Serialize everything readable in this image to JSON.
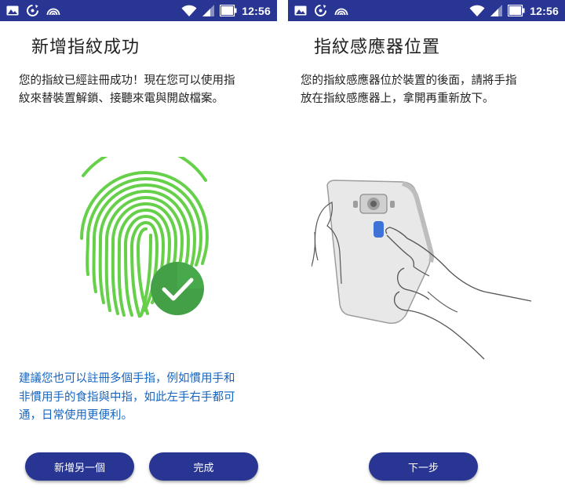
{
  "status_bar": {
    "time": "12:56",
    "background": "#283593",
    "left_icons": [
      "image-icon",
      "sync-icon",
      "hotspot-icon"
    ],
    "right_icons": [
      "wifi-icon",
      "cellular-signal-icon",
      "battery-icon"
    ]
  },
  "left_screen": {
    "title": "新增指紋成功",
    "body_lines": [
      "您的指紋已經註冊成功！現在您可以使用指",
      "紋來替裝置解鎖、接聽來電與開啟檔案。"
    ],
    "illustration_icon": "fingerprint-icon",
    "success_icon": "check-icon",
    "tip_lines": [
      "建議您也可以註冊多個手指，例如慣用手和",
      "非慣用手的食指與中指，如此左手右手都可",
      "通，日常使用更便利。"
    ],
    "buttons": {
      "add_another": "新增另一個",
      "done": "完成"
    }
  },
  "right_screen": {
    "title": "指紋感應器位置",
    "body_lines": [
      "您的指紋感應器位於裝置的後面，請將手指",
      "放在指紋感應器上，拿開再重新放下。"
    ],
    "illustration_icon": "hand-holding-phone-icon",
    "buttons": {
      "next": "下一步"
    }
  },
  "colors": {
    "accent": "#283593",
    "tip_text": "#1565c0",
    "fingerprint": "#66d04a",
    "success": "#43a047",
    "sensor": "#3f72d8"
  }
}
